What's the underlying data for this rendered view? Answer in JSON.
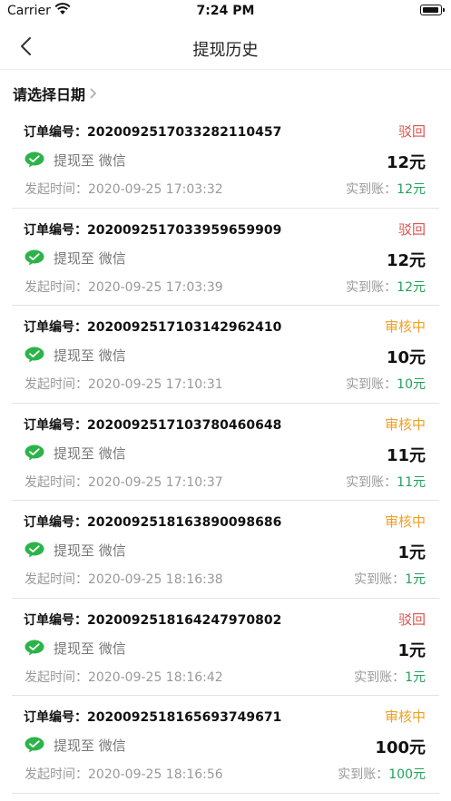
{
  "status_bar": {
    "carrier": "Carrier",
    "time": "7:24 PM"
  },
  "nav": {
    "title": "提现历史"
  },
  "filter": {
    "label": "请选择日期"
  },
  "colors": {
    "rejected": "#d9534f",
    "pending": "#f0a020",
    "received": "#21a15a",
    "wechat": "#2db34a"
  },
  "labels": {
    "order_prefix": "订单编号：",
    "method": "提现至 微信",
    "date_prefix": "发起时间：",
    "received_prefix": "实到账："
  },
  "records": [
    {
      "order_no": "20200925170332821104​57",
      "status": "驳回",
      "status_type": "rejected",
      "amount": "12元",
      "date": "2020-09-25 17:03:32",
      "received": "12元"
    },
    {
      "order_no": "20200925170339596599​09",
      "status": "驳回",
      "status_type": "rejected",
      "amount": "12元",
      "date": "2020-09-25 17:03:39",
      "received": "12元"
    },
    {
      "order_no": "20200925171031429624​10",
      "status": "审核中",
      "status_type": "pending",
      "amount": "10元",
      "date": "2020-09-25 17:10:31",
      "received": "10元"
    },
    {
      "order_no": "20200925171037804606​48",
      "status": "审核中",
      "status_type": "pending",
      "amount": "11元",
      "date": "2020-09-25 17:10:37",
      "received": "11元"
    },
    {
      "order_no": "20200925181638900986​86",
      "status": "审核中",
      "status_type": "pending",
      "amount": "1元",
      "date": "2020-09-25 18:16:38",
      "received": "1元"
    },
    {
      "order_no": "20200925181642479708​02",
      "status": "驳回",
      "status_type": "rejected",
      "amount": "1元",
      "date": "2020-09-25 18:16:42",
      "received": "1元"
    },
    {
      "order_no": "20200925181656937496​71",
      "status": "审核中",
      "status_type": "pending",
      "amount": "100元",
      "date": "2020-09-25 18:16:56",
      "received": "100元"
    }
  ]
}
